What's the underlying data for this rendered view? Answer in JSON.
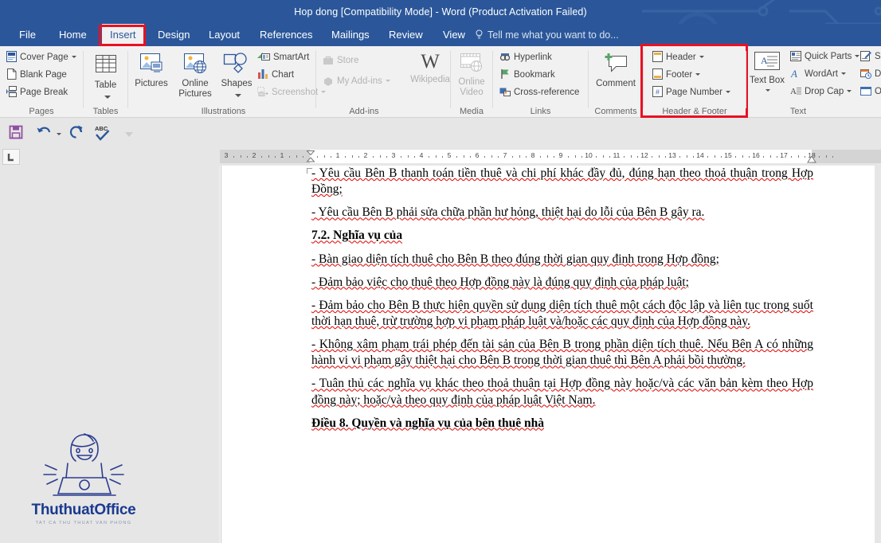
{
  "window": {
    "title": "Hop dong [Compatibility Mode] - Word (Product Activation Failed)"
  },
  "tabs": [
    {
      "label": "File",
      "active": false
    },
    {
      "label": "Home",
      "active": false
    },
    {
      "label": "Insert",
      "active": true
    },
    {
      "label": "Design",
      "active": false
    },
    {
      "label": "Layout",
      "active": false
    },
    {
      "label": "References",
      "active": false
    },
    {
      "label": "Mailings",
      "active": false
    },
    {
      "label": "Review",
      "active": false
    },
    {
      "label": "View",
      "active": false
    }
  ],
  "tell_me": {
    "placeholder": "Tell me what you want to do...",
    "icon": "lightbulb-icon"
  },
  "ribbon": {
    "groups": [
      {
        "name": "Pages",
        "label": "Pages",
        "items": [
          {
            "label": "Cover Page",
            "icon": "cover-page-icon",
            "dropdown": true
          },
          {
            "label": "Blank Page",
            "icon": "blank-page-icon",
            "dropdown": false
          },
          {
            "label": "Page Break",
            "icon": "page-break-icon",
            "dropdown": false
          }
        ]
      },
      {
        "name": "Tables",
        "label": "Tables",
        "items": [
          {
            "label": "Table",
            "icon": "table-icon",
            "dropdown": true
          }
        ]
      },
      {
        "name": "Illustrations",
        "label": "Illustrations",
        "items": [
          {
            "label": "Pictures",
            "icon": "pictures-icon",
            "dropdown": false
          },
          {
            "label": "Online Pictures",
            "icon": "online-pictures-icon",
            "dropdown": false
          },
          {
            "label": "Shapes",
            "icon": "shapes-icon",
            "dropdown": true
          },
          {
            "label": "SmartArt",
            "icon": "smartart-icon",
            "dropdown": false
          },
          {
            "label": "Chart",
            "icon": "chart-icon",
            "dropdown": false
          },
          {
            "label": "Screenshot",
            "icon": "screenshot-icon",
            "dropdown": true,
            "disabled": true
          }
        ]
      },
      {
        "name": "Add-ins",
        "label": "Add-ins",
        "items": [
          {
            "label": "Store",
            "icon": "store-icon",
            "dropdown": false,
            "disabled": true
          },
          {
            "label": "My Add-ins",
            "icon": "my-addins-icon",
            "dropdown": true,
            "disabled": true
          },
          {
            "label": "Wikipedia",
            "icon": "wikipedia-icon",
            "dropdown": false,
            "disabled": true
          }
        ]
      },
      {
        "name": "Media",
        "label": "Media",
        "items": [
          {
            "label": "Online Video",
            "icon": "online-video-icon",
            "dropdown": false,
            "disabled": true
          }
        ]
      },
      {
        "name": "Links",
        "label": "Links",
        "items": [
          {
            "label": "Hyperlink",
            "icon": "hyperlink-icon",
            "dropdown": false
          },
          {
            "label": "Bookmark",
            "icon": "bookmark-icon",
            "dropdown": false
          },
          {
            "label": "Cross-reference",
            "icon": "cross-reference-icon",
            "dropdown": false
          }
        ]
      },
      {
        "name": "Comments",
        "label": "Comments",
        "items": [
          {
            "label": "Comment",
            "icon": "new-comment-icon",
            "dropdown": false
          }
        ]
      },
      {
        "name": "HeaderFooter",
        "label": "Header & Footer",
        "highlighted": true,
        "items": [
          {
            "label": "Header",
            "icon": "header-icon",
            "dropdown": true
          },
          {
            "label": "Footer",
            "icon": "footer-icon",
            "dropdown": true
          },
          {
            "label": "Page Number",
            "icon": "page-number-icon",
            "dropdown": true
          }
        ]
      },
      {
        "name": "Text",
        "label": "Text",
        "items": [
          {
            "label": "Text Box",
            "icon": "text-box-icon",
            "dropdown": true
          },
          {
            "label": "Quick Parts",
            "icon": "quick-parts-icon",
            "dropdown": true
          },
          {
            "label": "WordArt",
            "icon": "wordart-icon",
            "dropdown": true
          },
          {
            "label": "Drop Cap",
            "icon": "drop-cap-icon",
            "dropdown": true
          },
          {
            "label": "Sig",
            "icon": "signature-line-icon",
            "dropdown": false
          },
          {
            "label": "Dat",
            "icon": "date-time-icon",
            "dropdown": false
          },
          {
            "label": "Obj",
            "icon": "object-icon",
            "dropdown": false
          }
        ]
      }
    ]
  },
  "quick_access": [
    {
      "name": "save-button",
      "icon": "save-icon",
      "color": "#8f4fa0"
    },
    {
      "name": "undo-button",
      "icon": "undo-icon",
      "color": "#2b579a",
      "dropdown": true
    },
    {
      "name": "redo-button",
      "icon": "redo-icon",
      "color": "#2b579a"
    },
    {
      "name": "spelling-check-button",
      "icon": "spelling-check-icon",
      "color": "#2b579a"
    },
    {
      "name": "customize-qat-button",
      "icon": "chevron-down-icon",
      "color": "#c8c8c8"
    }
  ],
  "ruler": {
    "left_numbers": [
      3,
      2,
      1
    ],
    "right_numbers": [
      1,
      2,
      3,
      4,
      5,
      6,
      7,
      8,
      9,
      10,
      11,
      12,
      13,
      14,
      15,
      16,
      17,
      18
    ],
    "tab_stop_selector": "left-tab-stop"
  },
  "logo": {
    "title": "ThuthuatOffice",
    "tagline": "TAT CA THU THUAT VAN PHONG",
    "image": "person-at-laptop-icon"
  },
  "document": {
    "paragraphs": [
      {
        "bold": false,
        "text": "- Yêu cầu Bên B thanh toán tiền thuê và chi phí khác đầy đủ, đúng hạn theo thoả thuận trong Hợp Đồng;"
      },
      {
        "bold": false,
        "text": "- Yêu cầu Bên B phải sửa chữa phần hư hỏng, thiệt hại do lỗi của Bên B gây ra."
      },
      {
        "bold": true,
        "text": "7.2. Nghĩa vụ của"
      },
      {
        "bold": false,
        "text": "- Bàn giao diện tích thuê cho Bên B theo đúng thời gian quy định trong Hợp đồng;"
      },
      {
        "bold": false,
        "text": "- Đảm bảo việc cho thuê theo Hợp đồng này là đúng quy định của pháp luật;"
      },
      {
        "bold": false,
        "text": "- Đảm bảo cho Bên B thực hiện quyền sử dụng diện tích thuê một cách độc lập và liên tục trong suốt thời hạn thuê, trừ trường hợp vi phạm pháp luật và/hoặc các quy định của Hợp đồng này."
      },
      {
        "bold": false,
        "text": "- Không xâm phạm trái phép đến tài sản của Bên B trong phần diện tích thuê. Nếu Bên A có những hành vi vi phạm gây thiệt hại cho Bên B trong thời gian thuê thì Bên A phải bồi thường."
      },
      {
        "bold": false,
        "text": "- Tuân thủ các nghĩa vụ khác theo thoả thuận tại Hợp đồng này hoặc/và các văn bản kèm theo Hợp đồng này; hoặc/và theo quy định của pháp luật Việt Nam."
      },
      {
        "bold": true,
        "text": "Điều 8. Quyền và nghĩa vụ của bên thuê nhà"
      }
    ]
  },
  "colors": {
    "title_bar": "#2b579a",
    "ribbon_bg": "#f1f1f1",
    "highlight": "#e81123",
    "pane_bg": "#e6e6e6",
    "accent_text": "#2b579a"
  }
}
